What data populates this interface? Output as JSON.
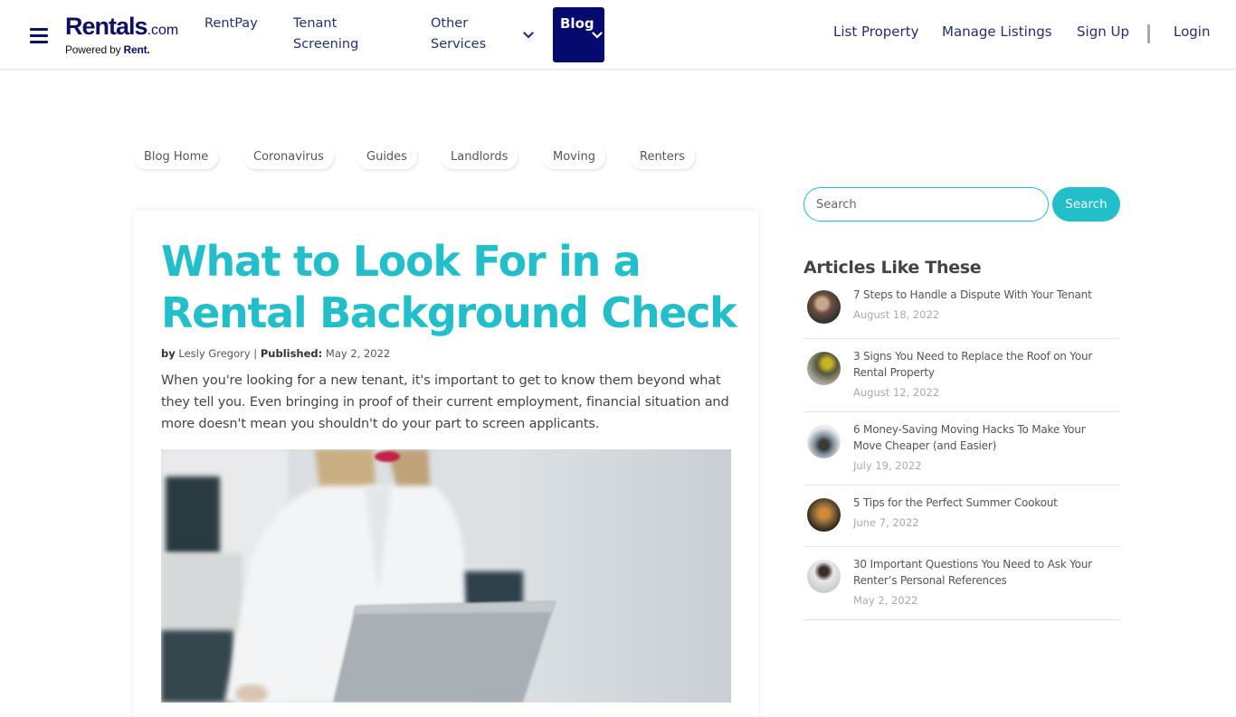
{
  "header": {
    "logo": {
      "main": "Rentals",
      "suffix": ".com",
      "powered_by": "Powered by",
      "brand": "Rent."
    },
    "nav": [
      {
        "label_lines": [
          "RentPay"
        ]
      },
      {
        "label_lines": [
          "Tenant",
          "Screening"
        ]
      },
      {
        "label_lines": [
          "Other",
          "Services"
        ],
        "has_dropdown": true
      },
      {
        "label": "Blog",
        "active": true,
        "has_dropdown": true
      }
    ],
    "right_links": [
      "List Property",
      "Manage Listings",
      "Sign Up",
      "Login"
    ]
  },
  "categories": [
    "Blog Home",
    "Coronavirus",
    "Guides",
    "Landlords",
    "Moving",
    "Renters"
  ],
  "article": {
    "title": "What to Look For in a Rental Background Check",
    "by_label": "by",
    "author": "Lesly Gregory",
    "published_label": "Published:",
    "published_date": "May 2, 2022",
    "intro": "When you're looking for a new tenant, it's important to get to know them beyond what they tell you. Even bringing in proof of their current employment, financial situation and more doesn't mean you shouldn't do your part to screen applicants.",
    "hero_image": "woman-with-laptop-photo"
  },
  "sidebar": {
    "search": {
      "placeholder": "Search",
      "value": "",
      "button_label": "Search"
    },
    "related_title": "Articles Like These",
    "articles": [
      {
        "title": "7 Steps to Handle a Dispute With Your Tenant",
        "date": "August 18, 2022"
      },
      {
        "title": "3 Signs You Need to Replace the Roof on Your Rental Property",
        "date": "August 12, 2022"
      },
      {
        "title": "6 Money-Saving Moving Hacks To Make Your Move Cheaper (and Easier)",
        "date": "July 19, 2022"
      },
      {
        "title": "5 Tips for the Perfect Summer Cookout",
        "date": "June 7, 2022"
      },
      {
        "title": "30 Important Questions You Need to Ask Your Renter’s Personal References",
        "date": "May 2, 2022"
      }
    ]
  },
  "colors": {
    "brand_navy": "#0d1163",
    "blog_active": "#050a6e",
    "accent_teal": "#22bfcb"
  }
}
